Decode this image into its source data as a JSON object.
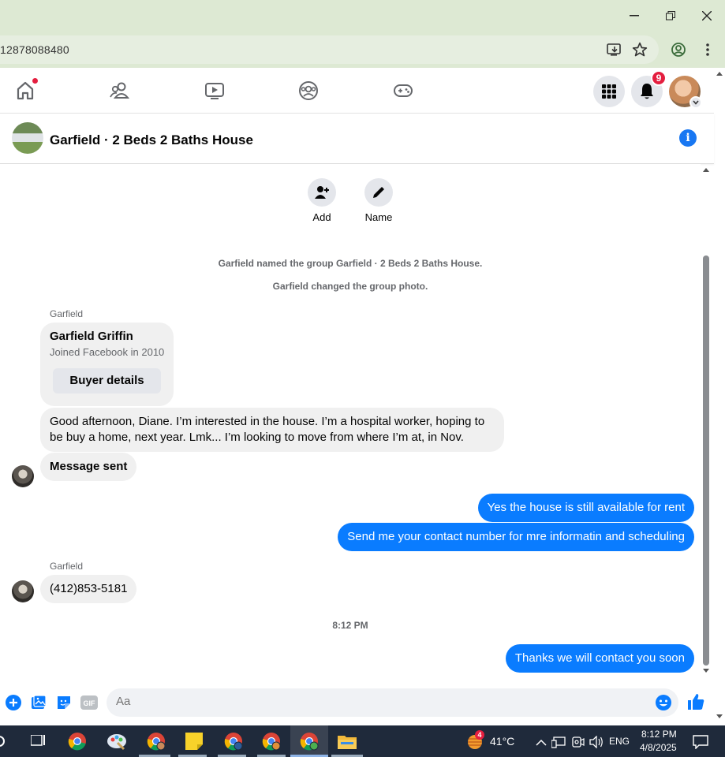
{
  "browser": {
    "url": "12878088480"
  },
  "fb_nav": {
    "notification_count": "9"
  },
  "chat": {
    "title": "Garfield · 2 Beds 2 Baths House",
    "actions": [
      {
        "label": "Add"
      },
      {
        "label": "Name"
      }
    ],
    "system_messages": [
      "Garfield named the group Garfield · 2 Beds 2 Baths House.",
      "Garfield changed the group photo."
    ],
    "card": {
      "sender": "Garfield",
      "name": "Garfield Griffin",
      "subtitle": "Joined Facebook in 2010",
      "button": "Buyer details"
    },
    "incoming_1": "Good afternoon, Diane. I’m interested in the house. I’m a hospital worker, hoping to be buy a home, next year. Lmk... I’m looking to move from where I’m at, in Nov.",
    "incoming_2": "Message sent",
    "outgoing_1": "Yes the house is still available for rent",
    "outgoing_2": "Send me your contact number for mre informatin and  scheduling",
    "sender_2": "Garfield",
    "incoming_3": "(412)853-5181",
    "timestamp": "8:12 PM",
    "outgoing_3": "Thanks we will contact you soon"
  },
  "composer": {
    "placeholder": "Aa",
    "gif_label": "GIF"
  },
  "taskbar": {
    "weather_temp": "41°C",
    "weather_badge": "4",
    "language": "ENG",
    "time": "8:12 PM",
    "date": "4/8/2025"
  },
  "colors": {
    "messenger_blue": "#0a7cff",
    "fb_blue": "#1877f2",
    "notification_red": "#e41e3f"
  }
}
